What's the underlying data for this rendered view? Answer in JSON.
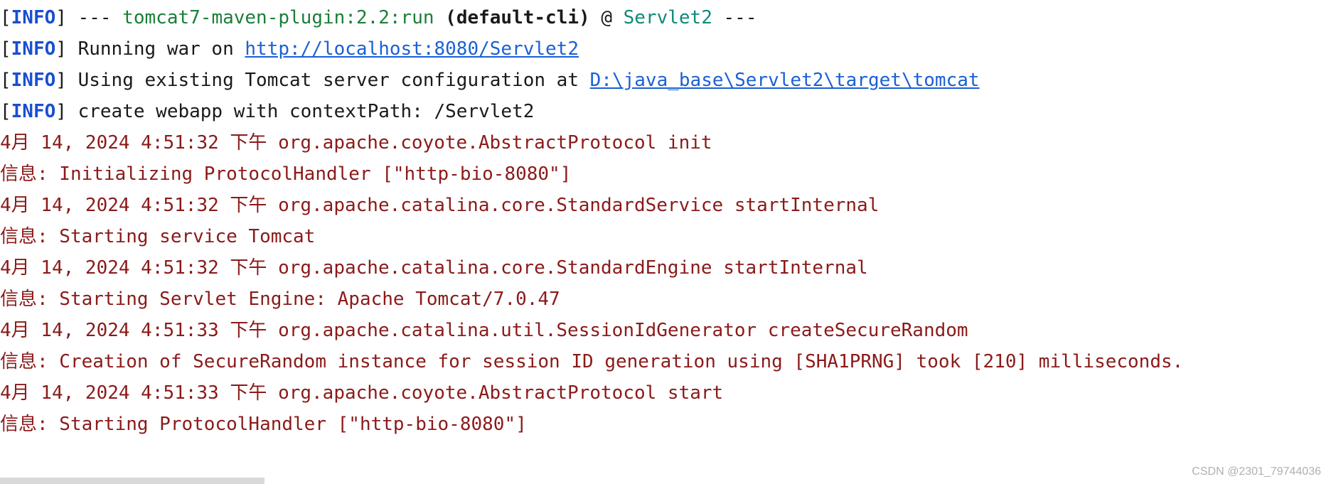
{
  "console": {
    "line1": {
      "open": "[",
      "tag": "INFO",
      "close": "]",
      "prefix": " --- ",
      "plugin": "tomcat7-maven-plugin:2.2:run",
      "goal": " (default-cli)",
      "at": " @ ",
      "artifact": "Servlet2",
      "suffix": " ---"
    },
    "line2": {
      "open": "[",
      "tag": "INFO",
      "close": "]",
      "text": " Running war on ",
      "link": "http://localhost:8080/Servlet2"
    },
    "line3": {
      "open": "[",
      "tag": "INFO",
      "close": "]",
      "text": " Using existing Tomcat server configuration at ",
      "link": "D:\\java_base\\Servlet2\\target\\tomcat"
    },
    "line4": {
      "open": "[",
      "tag": "INFO",
      "close": "]",
      "text": " create webapp with contextPath: /Servlet2"
    },
    "log_lines": [
      "4月 14, 2024 4:51:32 下午 org.apache.coyote.AbstractProtocol init",
      "信息: Initializing ProtocolHandler [\"http-bio-8080\"]",
      "4月 14, 2024 4:51:32 下午 org.apache.catalina.core.StandardService startInternal",
      "信息: Starting service Tomcat",
      "4月 14, 2024 4:51:32 下午 org.apache.catalina.core.StandardEngine startInternal",
      "信息: Starting Servlet Engine: Apache Tomcat/7.0.47",
      "4月 14, 2024 4:51:33 下午 org.apache.catalina.util.SessionIdGenerator createSecureRandom",
      "信息: Creation of SecureRandom instance for session ID generation using [SHA1PRNG] took [210] milliseconds.",
      "4月 14, 2024 4:51:33 下午 org.apache.coyote.AbstractProtocol start",
      "信息: Starting ProtocolHandler [\"http-bio-8080\"]"
    ]
  },
  "watermark": "CSDN @2301_79744036",
  "colors": {
    "info_tag": "#1a4fd0",
    "plugin": "#1a7f37",
    "artifact": "#0f8a7a",
    "link": "#1a60d6",
    "log_red": "#8b1a1a"
  }
}
